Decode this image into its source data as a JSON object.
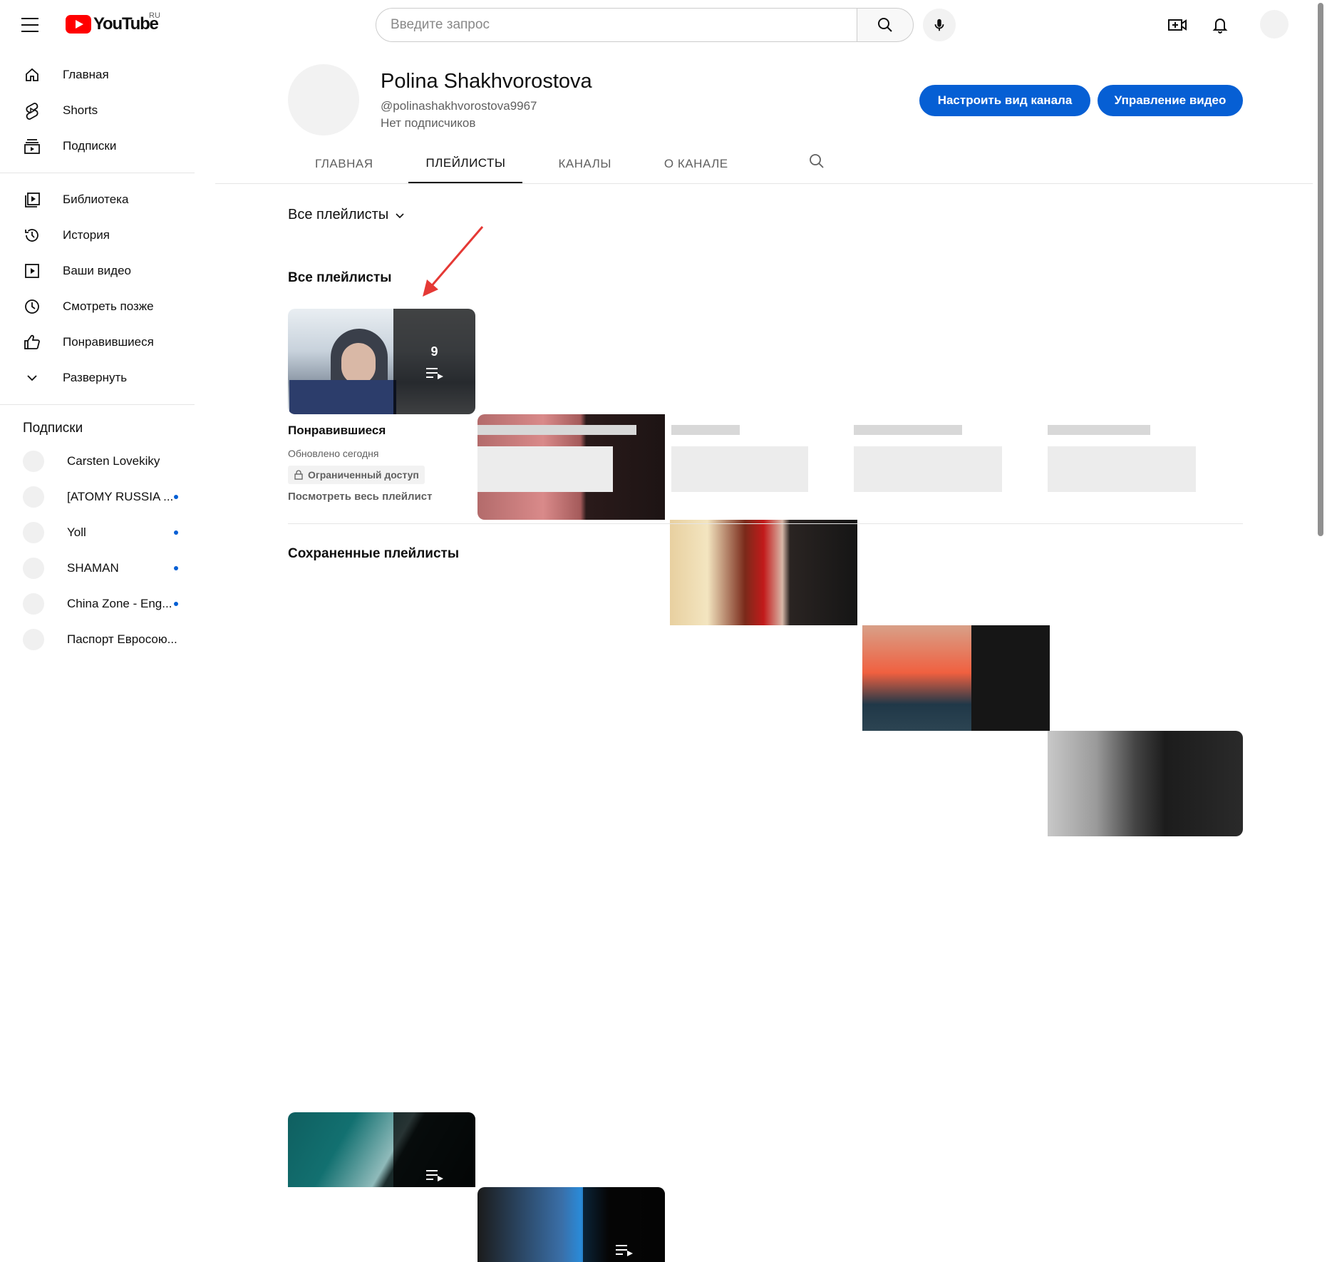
{
  "header": {
    "logo_text": "YouTube",
    "region": "RU",
    "search_placeholder": "Введите запрос"
  },
  "sidebar": {
    "main": [
      {
        "label": "Главная",
        "icon": "home-icon"
      },
      {
        "label": "Shorts",
        "icon": "shorts-icon"
      },
      {
        "label": "Подписки",
        "icon": "subscriptions-icon"
      }
    ],
    "library": [
      {
        "label": "Библиотека",
        "icon": "library-icon"
      },
      {
        "label": "История",
        "icon": "history-icon"
      },
      {
        "label": "Ваши видео",
        "icon": "your-videos-icon"
      },
      {
        "label": "Смотреть позже",
        "icon": "watch-later-icon"
      },
      {
        "label": "Понравившиеся",
        "icon": "liked-icon"
      },
      {
        "label": "Развернуть",
        "icon": "chevron-down-icon"
      }
    ],
    "subscriptions_heading": "Подписки",
    "subscriptions": [
      {
        "name": "Carsten Lovekiky",
        "new": false
      },
      {
        "name": "[ATOMY RUSSIA ...",
        "new": true
      },
      {
        "name": "Yoll",
        "new": true
      },
      {
        "name": "SHAMAN",
        "new": true
      },
      {
        "name": "China Zone - Eng...",
        "new": true
      },
      {
        "name": "Паспорт Евросою...",
        "new": false
      }
    ]
  },
  "channel": {
    "name": "Polina Shakhvorostova",
    "handle": "@polinashakhvorostova9967",
    "subscribers": "Нет подписчиков",
    "customize_button": "Настроить вид канала",
    "manage_button": "Управление видео"
  },
  "tabs": [
    {
      "label": "ГЛАВНАЯ",
      "active": false
    },
    {
      "label": "ПЛЕЙЛИСТЫ",
      "active": true
    },
    {
      "label": "КАНАЛЫ",
      "active": false
    },
    {
      "label": "О КАНАЛЕ",
      "active": false
    }
  ],
  "content": {
    "filter_label": "Все плейлисты",
    "all_playlists_title": "Все плейлисты",
    "saved_playlists_title": "Сохраненные плейлисты",
    "featured_playlist": {
      "title": "Понравившиеся",
      "count": "9",
      "updated": "Обновлено сегодня",
      "access": "Ограниченный доступ",
      "view_all": "Посмотреть весь плейлист"
    }
  },
  "colors": {
    "accent_blue": "#065fd4",
    "logo_red": "#ff0000",
    "annotation_arrow": "#e53935",
    "notification_dot": "#065fd4"
  }
}
